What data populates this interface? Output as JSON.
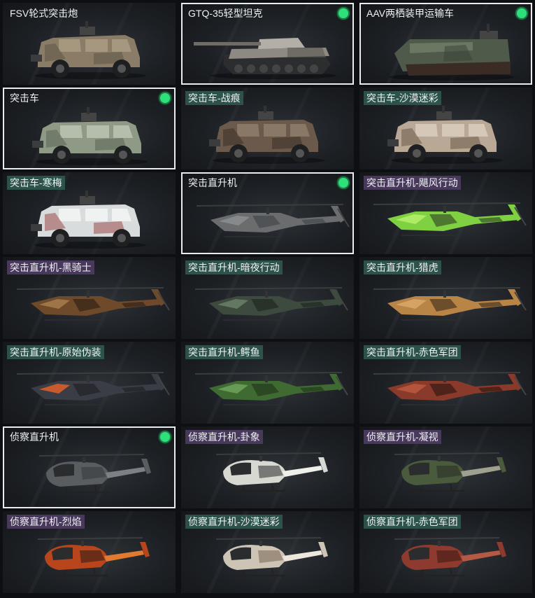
{
  "vehicles": [
    {
      "name": "FSV轮式突击炮",
      "kind": "fsv",
      "selected": false,
      "equipped": false,
      "tag": "plain",
      "body": "#8a7c66",
      "accent": "#a89a82",
      "camo": "#5f5546"
    },
    {
      "name": "GTQ-35轻型坦克",
      "kind": "tank",
      "selected": true,
      "equipped": true,
      "tag": "plain",
      "body": "#8e8a83",
      "accent": "#b3aea6",
      "camo": "#5a5652"
    },
    {
      "name": "AAV两栖装甲运输车",
      "kind": "aav",
      "selected": true,
      "equipped": true,
      "tag": "plain",
      "body": "#4f5a4a",
      "accent": "#6b7763",
      "camo": "#3a4236"
    },
    {
      "name": "突击车",
      "kind": "truck",
      "selected": true,
      "equipped": true,
      "tag": "plain",
      "body": "#8f9a86",
      "accent": "#b9c2b0",
      "camo": "#5b6454"
    },
    {
      "name": "突击车-战痕",
      "kind": "truck",
      "selected": false,
      "equipped": false,
      "tag": "teal",
      "body": "#6b5a4c",
      "accent": "#8d7b69",
      "camo": "#3d3028"
    },
    {
      "name": "突击车-沙漠迷彩",
      "kind": "truck",
      "selected": false,
      "equipped": false,
      "tag": "teal",
      "body": "#b9a896",
      "accent": "#d8cbbb",
      "camo": "#6e5a48"
    },
    {
      "name": "突击车-寒梅",
      "kind": "truck",
      "selected": false,
      "equipped": false,
      "tag": "teal",
      "body": "#d9dcdc",
      "accent": "#f2f3f3",
      "camo": "#9a4a4a"
    },
    {
      "name": "突击直升机",
      "kind": "heli",
      "selected": true,
      "equipped": true,
      "tag": "plain",
      "body": "#6a6c6e",
      "accent": "#8c8f92",
      "camo": "#404244"
    },
    {
      "name": "突击直升机-飓风行动",
      "kind": "heli",
      "selected": false,
      "equipped": false,
      "tag": "purple",
      "body": "#7fd142",
      "accent": "#b5f06a",
      "camo": "#2d3a24"
    },
    {
      "name": "突击直升机-黑骑士",
      "kind": "heli",
      "selected": false,
      "equipped": false,
      "tag": "purple",
      "body": "#6e4a2a",
      "accent": "#a87c4c",
      "camo": "#2a1c12"
    },
    {
      "name": "突击直升机-暗夜行动",
      "kind": "heli",
      "selected": false,
      "equipped": false,
      "tag": "teal",
      "body": "#3d4a3e",
      "accent": "#6a8068",
      "camo": "#1c231d"
    },
    {
      "name": "突击直升机-猎虎",
      "kind": "heli",
      "selected": false,
      "equipped": false,
      "tag": "teal",
      "body": "#b98546",
      "accent": "#d9a868",
      "camo": "#3a2a1a"
    },
    {
      "name": "突击直升机-原始伪装",
      "kind": "heli",
      "selected": false,
      "equipped": false,
      "tag": "teal",
      "body": "#3a3d45",
      "accent": "#e0602a",
      "camo": "#1c1e22"
    },
    {
      "name": "突击直升机-鳄鱼",
      "kind": "heli",
      "selected": false,
      "equipped": false,
      "tag": "teal",
      "body": "#3f6a32",
      "accent": "#6fa25a",
      "camo": "#1e3218"
    },
    {
      "name": "突击直升机-赤色军团",
      "kind": "heli",
      "selected": false,
      "equipped": false,
      "tag": "teal",
      "body": "#8a3a2a",
      "accent": "#b85a40",
      "camo": "#2a1410"
    },
    {
      "name": "侦察直升机",
      "kind": "scout",
      "selected": true,
      "equipped": true,
      "tag": "plain",
      "body": "#5a5d60",
      "accent": "#7d8185",
      "camo": "#35383b"
    },
    {
      "name": "侦察直升机-卦象",
      "kind": "scout",
      "selected": false,
      "equipped": false,
      "tag": "purple",
      "body": "#d8d8d2",
      "accent": "#f0f0ea",
      "camo": "#2a2a2a"
    },
    {
      "name": "侦察直升机-凝视",
      "kind": "scout",
      "selected": false,
      "equipped": false,
      "tag": "purple",
      "body": "#4a5a3c",
      "accent": "#a0a090",
      "camo": "#2a2e24"
    },
    {
      "name": "侦察直升机-烈焰",
      "kind": "scout",
      "selected": false,
      "equipped": false,
      "tag": "purple",
      "body": "#b8451c",
      "accent": "#e07a30",
      "camo": "#2a1a14"
    },
    {
      "name": "侦察直升机-沙漠迷彩",
      "kind": "scout",
      "selected": false,
      "equipped": false,
      "tag": "teal",
      "body": "#cdc4b6",
      "accent": "#ece6dc",
      "camo": "#7a6450"
    },
    {
      "name": "侦察直升机-赤色军团",
      "kind": "scout",
      "selected": false,
      "equipped": false,
      "tag": "teal",
      "body": "#8e3a2e",
      "accent": "#b45a44",
      "camo": "#3a1812"
    }
  ]
}
